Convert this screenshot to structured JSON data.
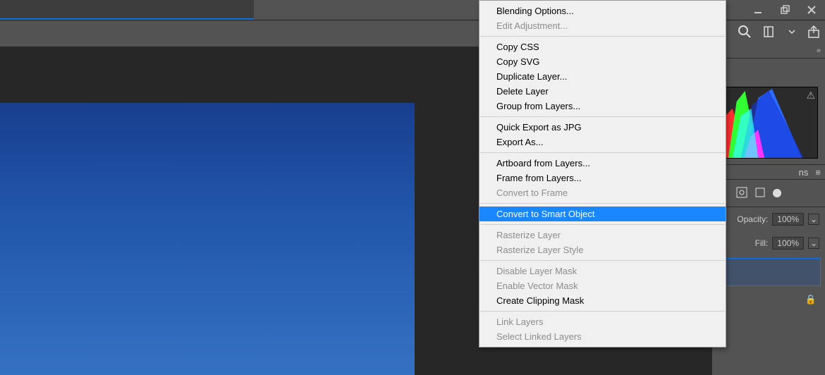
{
  "window": {
    "minimize": "_",
    "restore": "❐",
    "close": "✕"
  },
  "toolbar_icons": {
    "search": "search-icon",
    "view": "viewmode-icon",
    "share": "share-icon"
  },
  "panels_expand": "»",
  "histogram_warning": "⚠",
  "opacity_label": "Opacity:",
  "opacity_value": "100%",
  "fill_label": "Fill:",
  "fill_value": "100%",
  "layers_tab_suffix": "ns",
  "panel_menu_glyph": "≡",
  "dropdown_glyph": "⌄",
  "lock_glyph": "🔒",
  "menu": {
    "blending_options": "Blending Options...",
    "edit_adjustment": "Edit Adjustment...",
    "copy_css": "Copy CSS",
    "copy_svg": "Copy SVG",
    "duplicate_layer": "Duplicate Layer...",
    "delete_layer": "Delete Layer",
    "group_from_layers": "Group from Layers...",
    "quick_export_jpg": "Quick Export as JPG",
    "export_as": "Export As...",
    "artboard_from_layers": "Artboard from Layers...",
    "frame_from_layers": "Frame from Layers...",
    "convert_to_frame": "Convert to Frame",
    "convert_to_smart": "Convert to Smart Object",
    "rasterize_layer": "Rasterize Layer",
    "rasterize_style": "Rasterize Layer Style",
    "disable_layer_mask": "Disable Layer Mask",
    "enable_vector_mask": "Enable Vector Mask",
    "create_clip_mask": "Create Clipping Mask",
    "link_layers": "Link Layers",
    "select_linked": "Select Linked Layers"
  }
}
